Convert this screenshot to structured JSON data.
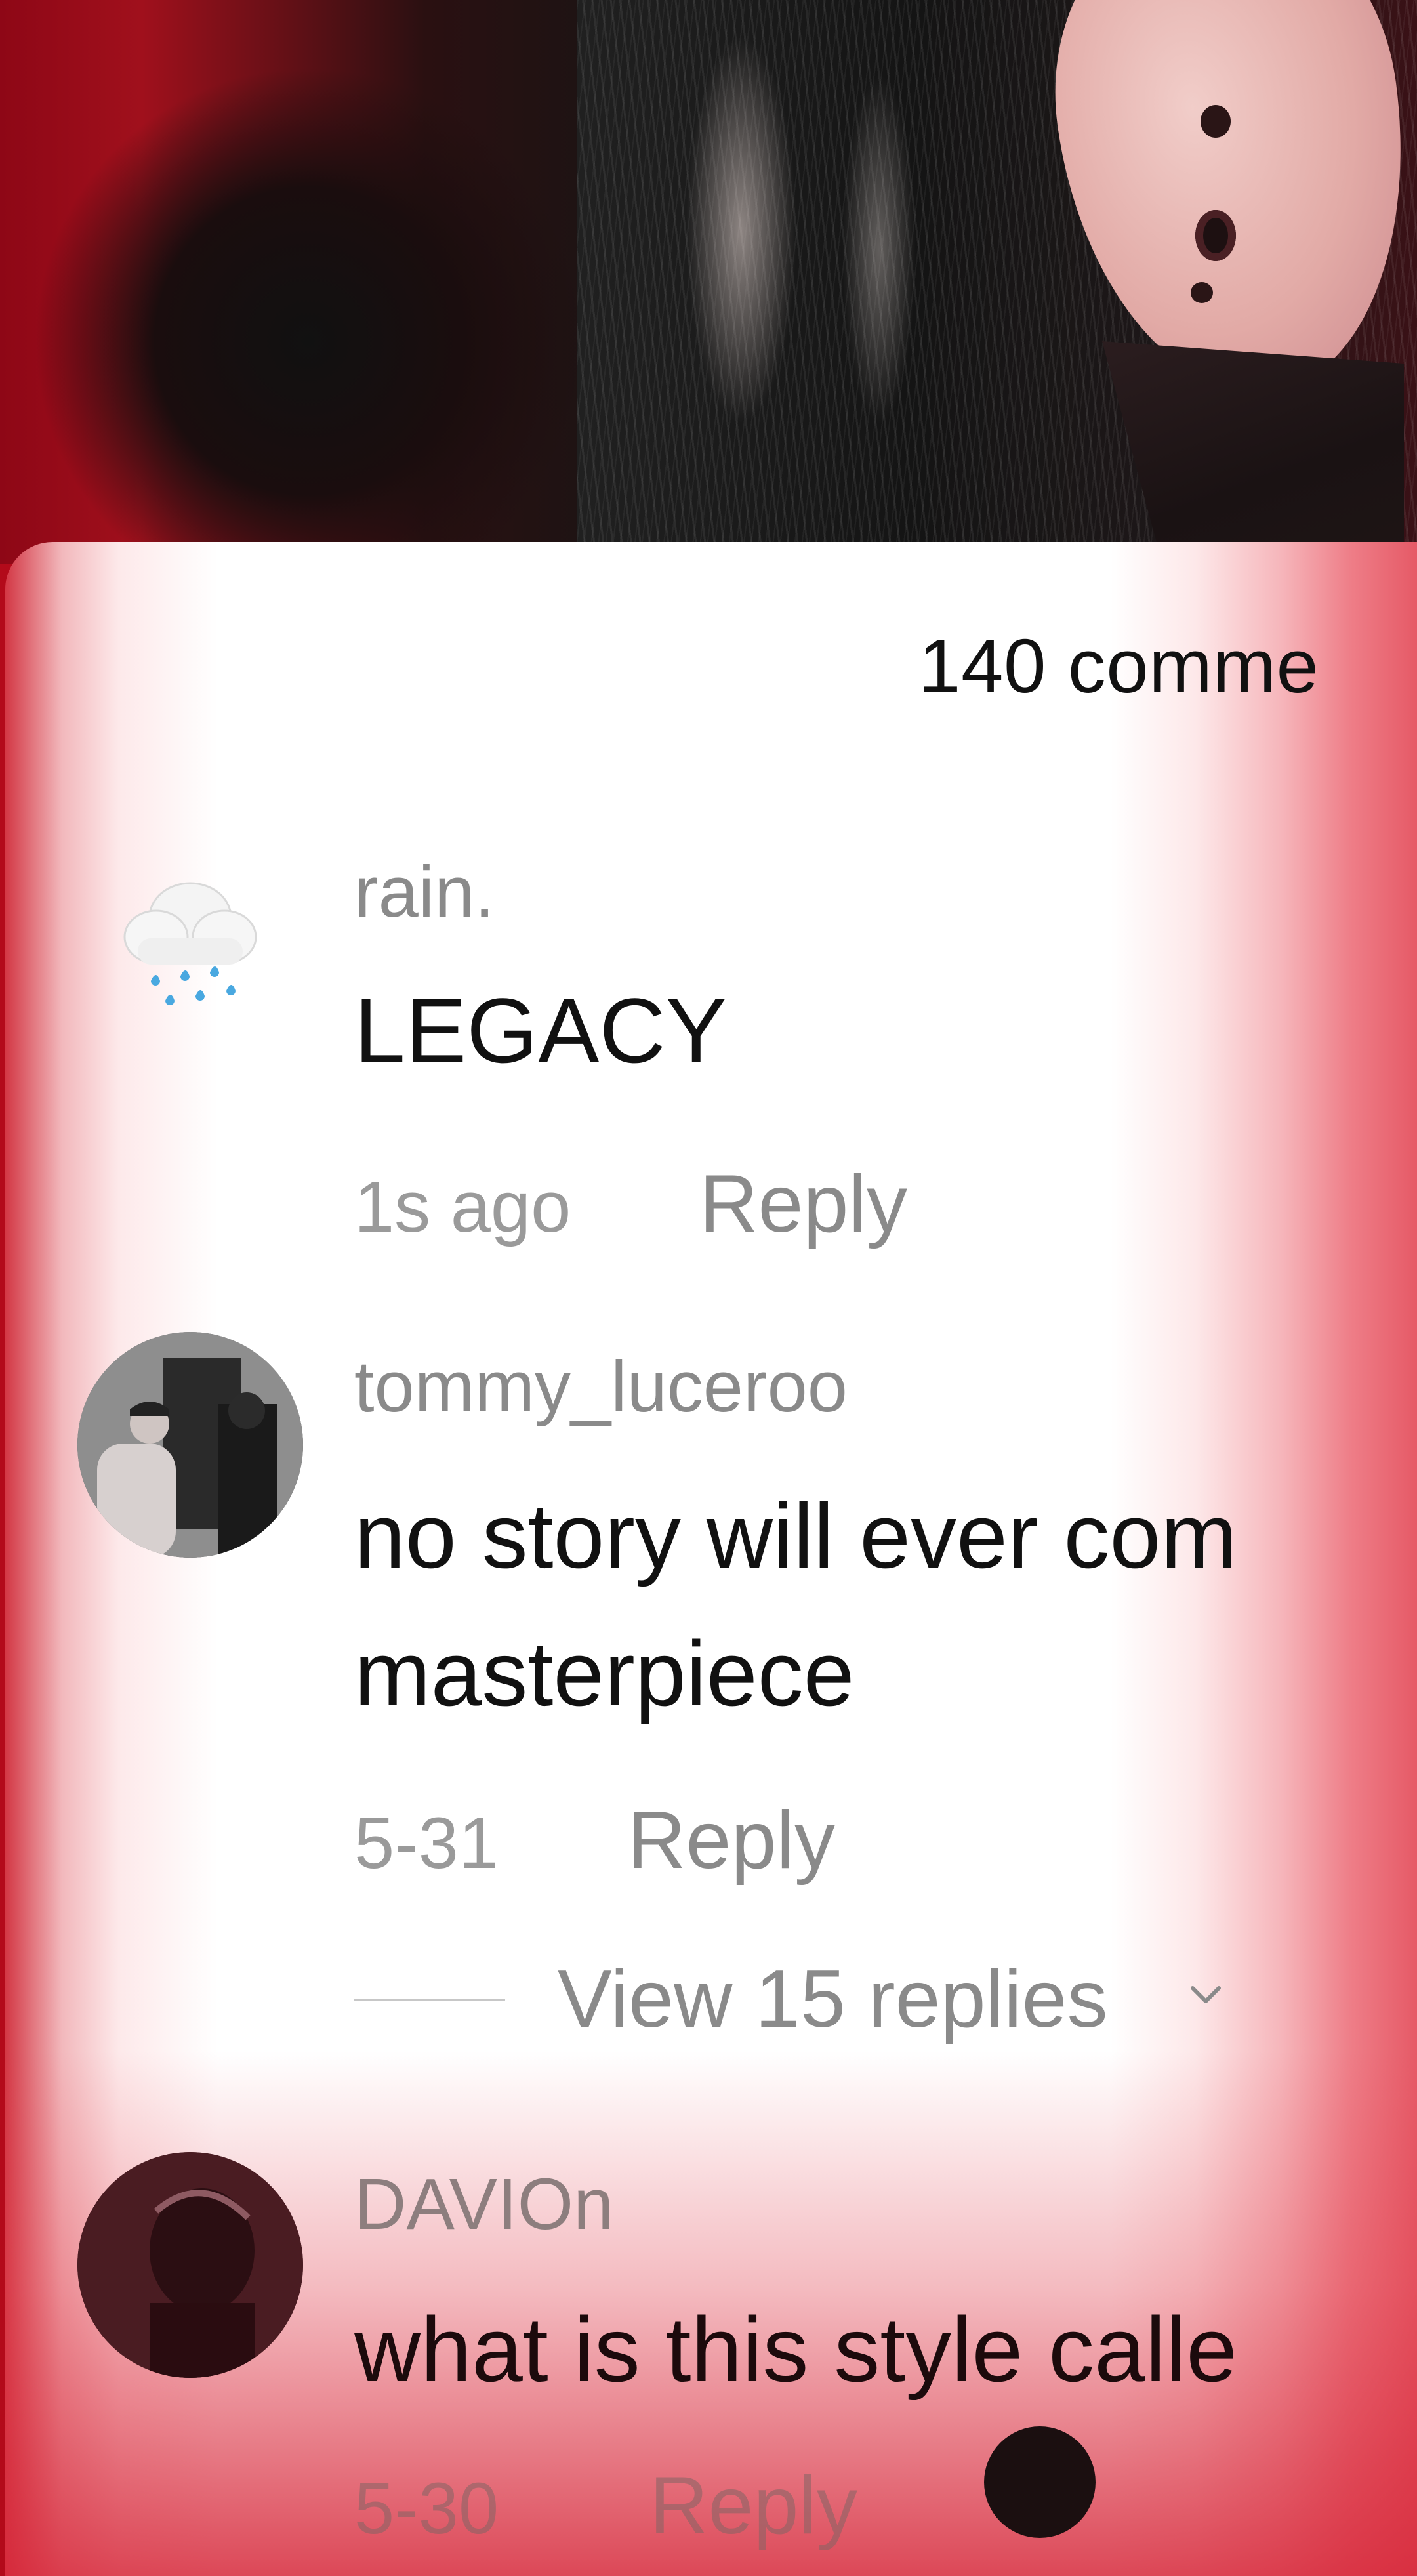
{
  "video": {
    "description_icon": "manga-artwork"
  },
  "comments_panel": {
    "count_label": "140 comme",
    "comments": [
      {
        "username": "rain.",
        "avatar_icon": "cloud-with-rain-icon",
        "text_lines": [
          "LEGACY"
        ],
        "time": "1s ago",
        "reply_label": "Reply"
      },
      {
        "username": "tommy_luceroo",
        "avatar_icon": "photo-avatar",
        "text_lines": [
          "no story will ever com",
          "masterpiece"
        ],
        "time": "5-31",
        "reply_label": "Reply",
        "view_replies_label": "View 15 replies"
      },
      {
        "username": "DAVIOn",
        "avatar_icon": "photo-avatar",
        "text_lines": [
          "what is this style calle"
        ],
        "time": "5-30",
        "reply_label": "Reply"
      }
    ]
  },
  "colors": {
    "accent_red": "#d33744",
    "text_dark": "#111111",
    "text_muted": "#8a8a8a"
  }
}
